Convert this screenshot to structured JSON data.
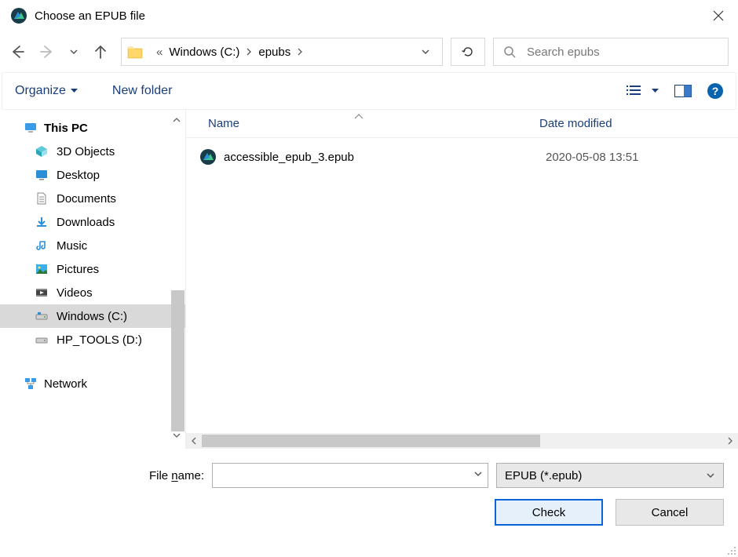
{
  "window_title": "Choose an EPUB file",
  "path": {
    "crumbs": [
      "Windows (C:)",
      "epubs"
    ],
    "prefix": "«"
  },
  "search": {
    "placeholder": "Search epubs"
  },
  "toolbar": {
    "organize": "Organize",
    "new_folder": "New folder"
  },
  "sidebar": {
    "root": "This PC",
    "items": [
      {
        "label": "3D Objects",
        "icon": "cube"
      },
      {
        "label": "Desktop",
        "icon": "desktop"
      },
      {
        "label": "Documents",
        "icon": "document"
      },
      {
        "label": "Downloads",
        "icon": "download"
      },
      {
        "label": "Music",
        "icon": "music"
      },
      {
        "label": "Pictures",
        "icon": "picture"
      },
      {
        "label": "Videos",
        "icon": "video"
      },
      {
        "label": "Windows (C:)",
        "icon": "drive",
        "selected": true
      },
      {
        "label": "HP_TOOLS (D:)",
        "icon": "drive"
      }
    ],
    "network": "Network"
  },
  "columns": {
    "name": "Name",
    "date": "Date modified"
  },
  "files": [
    {
      "name": "accessible_epub_3.epub",
      "date": "2020-05-08 13:51"
    }
  ],
  "bottom": {
    "filename_label_pre": "File ",
    "filename_label_u": "n",
    "filename_label_post": "ame:",
    "filetype": "EPUB (*.epub)",
    "check": "Check",
    "cancel": "Cancel"
  },
  "help_char": "?"
}
